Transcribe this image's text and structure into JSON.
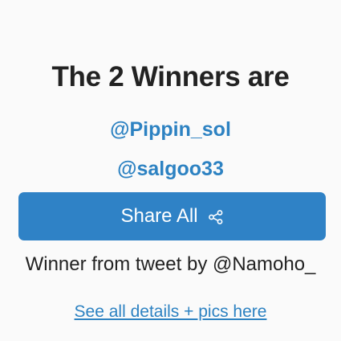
{
  "heading": "The 2 Winners are",
  "winners": [
    "@Pippin_sol",
    "@salgoo33"
  ],
  "share_button": {
    "label": "Share All",
    "icon": "share-icon"
  },
  "source_text": "Winner from tweet by @Namoho_",
  "details_link": "See all details + pics here",
  "colors": {
    "accent": "#2d82c2",
    "button_bg": "#2f82c6",
    "text": "#222222",
    "background": "#fafafa"
  }
}
